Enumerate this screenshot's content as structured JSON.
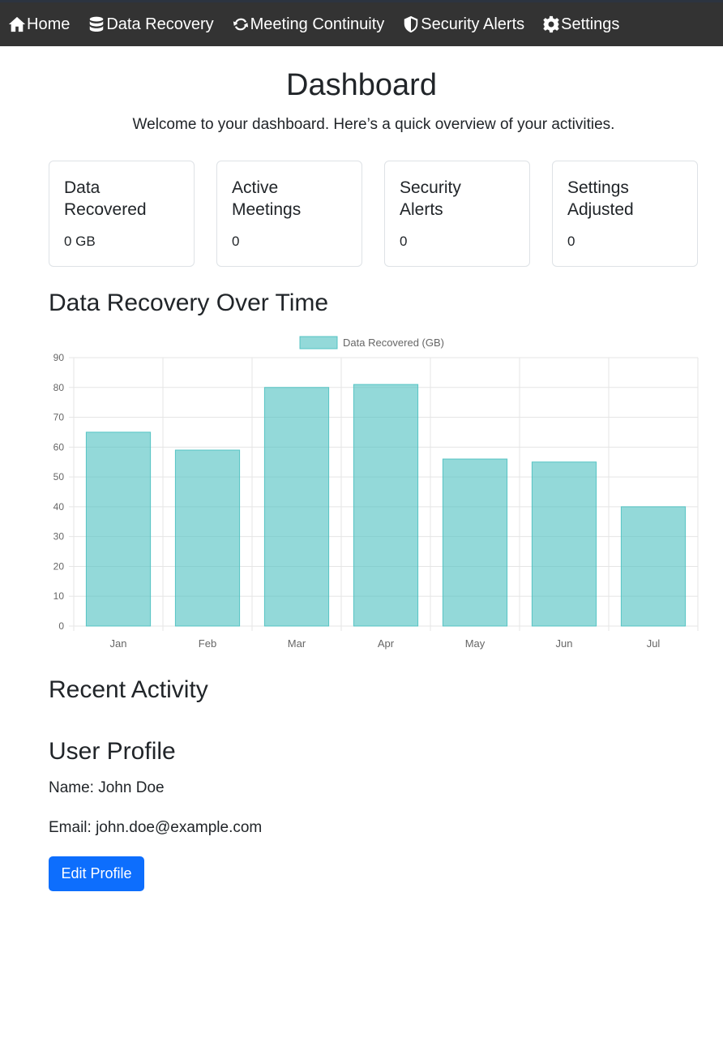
{
  "nav": {
    "items": [
      {
        "label": "Home",
        "icon": "home-icon"
      },
      {
        "label": "Data Recovery",
        "icon": "database-icon"
      },
      {
        "label": "Meeting Continuity",
        "icon": "sync-icon"
      },
      {
        "label": "Security Alerts",
        "icon": "shield-icon"
      },
      {
        "label": "Settings",
        "icon": "gear-icon"
      }
    ]
  },
  "header": {
    "title": "Dashboard",
    "subtitle": "Welcome to your dashboard. Here’s a quick overview of your activities."
  },
  "cards": [
    {
      "title": "Data Recovered",
      "value": "0 GB"
    },
    {
      "title": "Active Meetings",
      "value": "0"
    },
    {
      "title": "Security Alerts",
      "value": "0"
    },
    {
      "title": "Settings Adjusted",
      "value": "0"
    }
  ],
  "sections": {
    "chart_heading": "Data Recovery Over Time",
    "activity_heading": "Recent Activity",
    "profile_heading": "User Profile"
  },
  "profile": {
    "name_line": "Name: John Doe",
    "email_line": "Email: john.doe@example.com",
    "edit_label": "Edit Profile"
  },
  "colors": {
    "nav_bg": "#333333",
    "bar_fill": "#99d9d9",
    "button_bg": "#0d6efd"
  },
  "chart_data": {
    "type": "bar",
    "categories": [
      "Jan",
      "Feb",
      "Mar",
      "Apr",
      "May",
      "Jun",
      "Jul"
    ],
    "series": [
      {
        "name": "Data Recovered (GB)",
        "values": [
          65,
          59,
          80,
          81,
          56,
          55,
          40
        ]
      }
    ],
    "ylim": [
      0,
      90
    ],
    "yticks": [
      0,
      10,
      20,
      30,
      40,
      50,
      60,
      70,
      80,
      90
    ],
    "grid": true,
    "legend": "top-center"
  }
}
